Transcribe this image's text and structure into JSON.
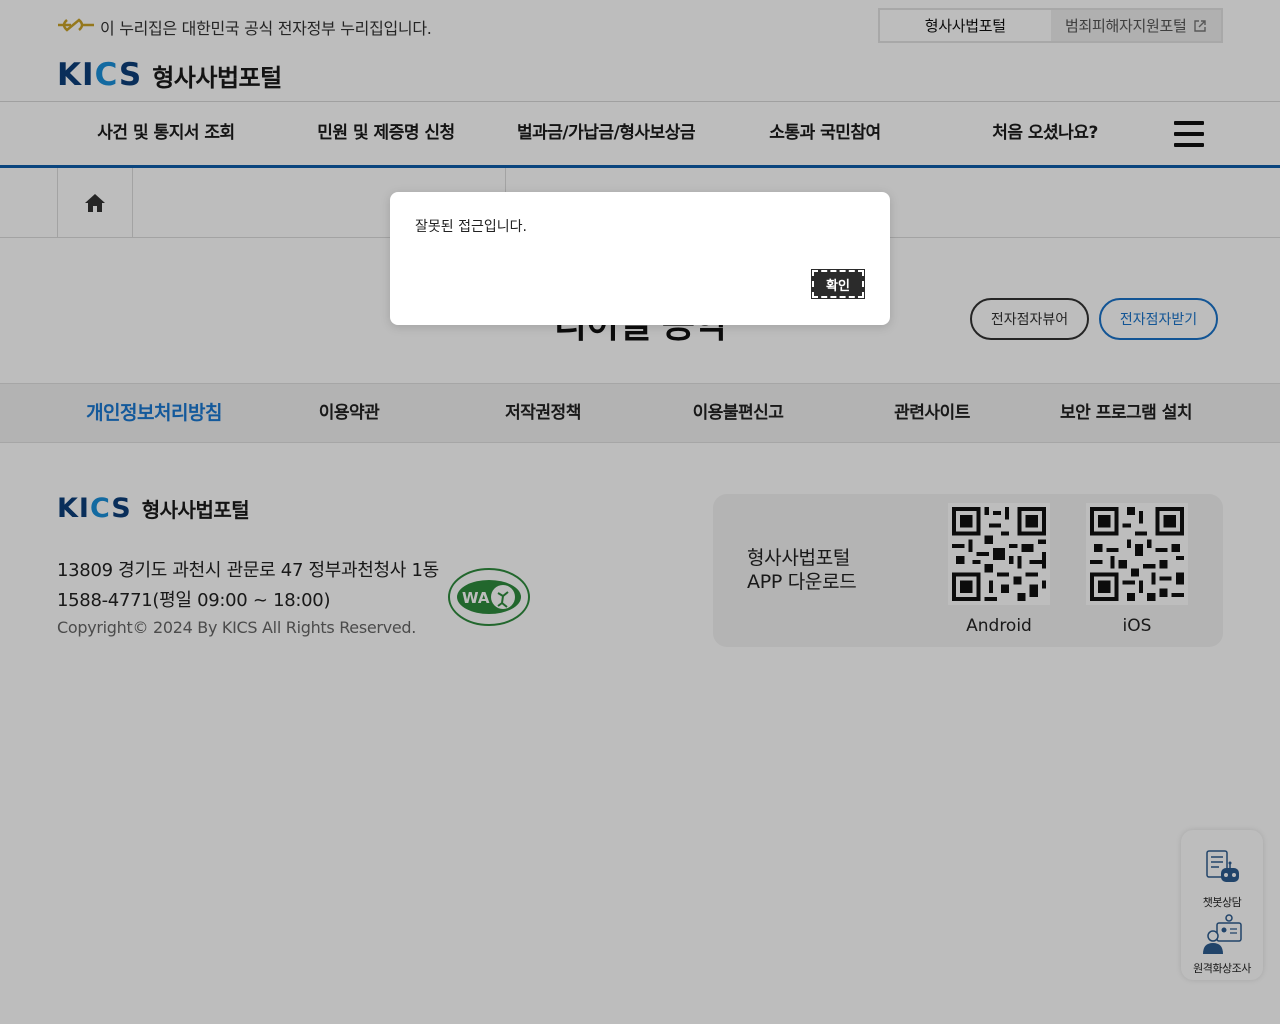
{
  "gov_banner": {
    "text": "이 누리집은 대한민국 공식 전자정부 누리집입니다."
  },
  "portal_switch": {
    "current": "형사사법포털",
    "other": "범죄피해자지원포털"
  },
  "header": {
    "logo_text": "KICS",
    "site_title": "형사사법포털"
  },
  "gnb": {
    "items": [
      "사건 및 통지서 조회",
      "민원 및 제증명 신청",
      "벌과금/가납금/형사보상금",
      "소통과 국민참여",
      "처음 오셨나요?"
    ]
  },
  "page": {
    "title_partial": "디이얼 공익"
  },
  "braille": {
    "viewer": "전자점자뷰어",
    "download": "전자점자받기"
  },
  "footer_nav": {
    "items": [
      "개인정보처리방침",
      "이용약관",
      "저작권정책",
      "이용불편신고",
      "관련사이트",
      "보안 프로그램 설치"
    ],
    "active_index": 0
  },
  "footer": {
    "logo_text": "KICS",
    "site_title": "형사사법포털",
    "address": "13809 경기도 과천시 관문로 47 정부과천청사 1동",
    "phone": "1588-4771(평일 09:00 ~ 18:00)",
    "copyright": "Copyright© 2024 By KICS All Rights Reserved.",
    "app": {
      "label_line1": "형사사법포털",
      "label_line2": "APP 다운로드",
      "android": "Android",
      "ios": "iOS"
    }
  },
  "float_widget": {
    "chatbot": "챗봇상담",
    "remote": "원격화상조사"
  },
  "dialog": {
    "message": "잘못된 접근입니다.",
    "ok": "확인"
  },
  "colors": {
    "accent": "#0e5eaa",
    "link": "#1a78d2",
    "brand": "#0d3f7a"
  }
}
